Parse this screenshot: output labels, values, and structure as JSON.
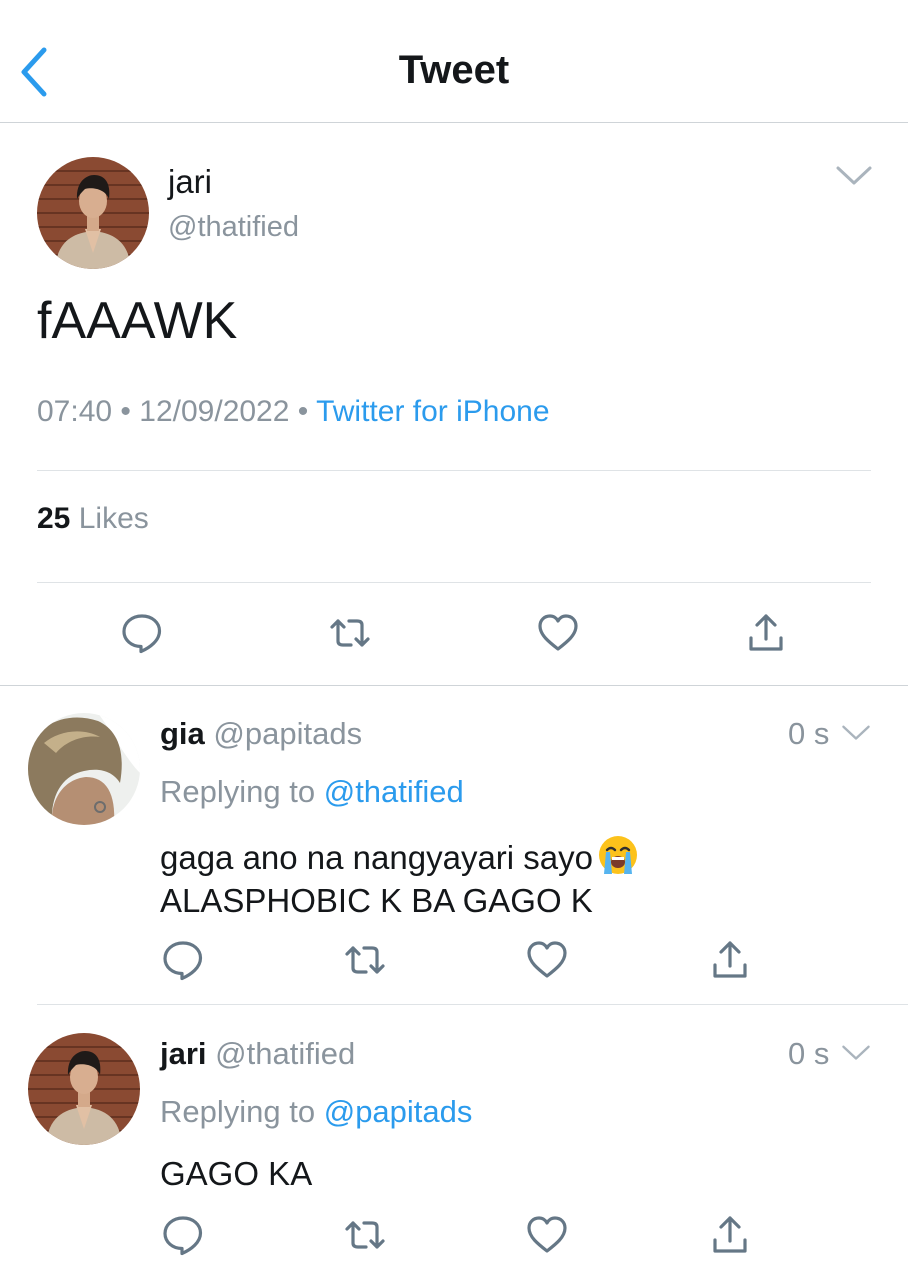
{
  "header": {
    "title": "Tweet"
  },
  "tweet": {
    "name": "jari",
    "handle": "@thatified",
    "text": "fAAAWK",
    "time": "07:40",
    "sep": "•",
    "date": "12/09/2022",
    "source": "Twitter for iPhone",
    "likes_count": "25",
    "likes_label": "Likes"
  },
  "replies": [
    {
      "name": "gia",
      "handle": "@papitads",
      "time": "0 s",
      "replying_label": "Replying to",
      "replying_to": "@thatified",
      "text_line1": "gaga ano na nangyayari sayo",
      "emoji": "loudly-crying-face",
      "text_line2": "ALASPHOBIC K BA GAGO K"
    },
    {
      "name": "jari",
      "handle": "@thatified",
      "time": "0 s",
      "replying_label": "Replying to",
      "replying_to": "@papitads",
      "text_line1": "GAGO KA"
    }
  ],
  "colors": {
    "accent": "#2b9bed",
    "secondary_text": "#8a949d",
    "icon": "#657786",
    "divider": "#dfe3e6"
  },
  "icons": [
    "back-chevron-icon",
    "chevron-down-icon",
    "reply-icon",
    "retweet-icon",
    "like-icon",
    "share-icon"
  ]
}
